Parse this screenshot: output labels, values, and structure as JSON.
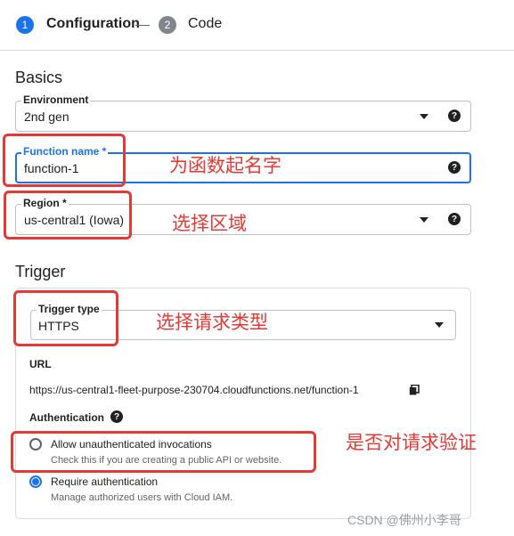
{
  "stepper": {
    "step1": {
      "number": "1",
      "label": "Configuration"
    },
    "step2": {
      "number": "2",
      "label": "Code"
    }
  },
  "basics": {
    "heading": "Basics",
    "environment": {
      "label": "Environment",
      "value": "2nd gen"
    },
    "function_name": {
      "label": "Function name *",
      "value": "function-1"
    },
    "region": {
      "label": "Region *",
      "value": "us-central1 (Iowa)"
    }
  },
  "trigger": {
    "heading": "Trigger",
    "trigger_type": {
      "label": "Trigger type",
      "value": "HTTPS"
    },
    "url_label": "URL",
    "url_value": "https://us-central1-fleet-purpose-230704.cloudfunctions.net/function-1",
    "authentication_label": "Authentication",
    "options": [
      {
        "label": "Allow unauthenticated invocations",
        "description": "Check this if you are creating a public API or website.",
        "selected": false
      },
      {
        "label": "Require authentication",
        "description": "Manage authorized users with Cloud IAM.",
        "selected": true
      }
    ]
  },
  "annotations": {
    "name_note": "为函数起名字",
    "region_note": "选择区域",
    "type_note": "选择请求类型",
    "auth_note": "是否对请求验证"
  },
  "watermark": "CSDN @佛州小李哥",
  "colors": {
    "accent": "#1a73e8",
    "annotation_red": "#e53935",
    "step_inactive": "#5f6368"
  },
  "icons": {
    "help": "help-circle-icon",
    "dropdown": "arrow-drop-down-icon",
    "copy": "copy-icon"
  }
}
